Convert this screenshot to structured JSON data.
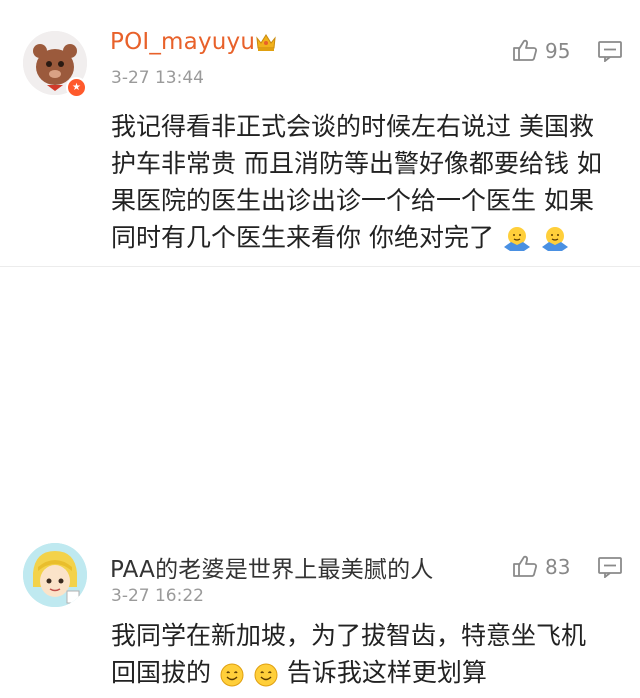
{
  "comments": [
    {
      "username": "POI_mayuyu",
      "timestamp": "3-27 13:44",
      "likes": "95",
      "text": [
        "我记得看非正式会谈的时候左右说过 美国救",
        "护车非常贵 而且消防等出警好像都要给钱 如",
        "果医院的医生出诊出诊一个给一个医生 如果",
        "同时有几个医生来看你 你绝对完了"
      ],
      "icons": {
        "like": "thumbs-up-icon",
        "reply": "comment-icon",
        "badge": "crown-icon",
        "emoji": "giving-up-hands-emoji"
      },
      "colors": {
        "username": "#e8612a",
        "verified_badge": "#ff5a2c"
      }
    },
    {
      "username": "PAA的老婆是世界上最美腻的人",
      "timestamp": "3-27 16:22",
      "likes": "83",
      "text": [
        "我同学在新加坡，为了拔智齿，特意坐飞机",
        "回国拔的",
        "告诉我这样更划算"
      ],
      "icons": {
        "like": "thumbs-up-icon",
        "reply": "comment-icon",
        "emoji": "smile-emoji"
      }
    }
  ]
}
